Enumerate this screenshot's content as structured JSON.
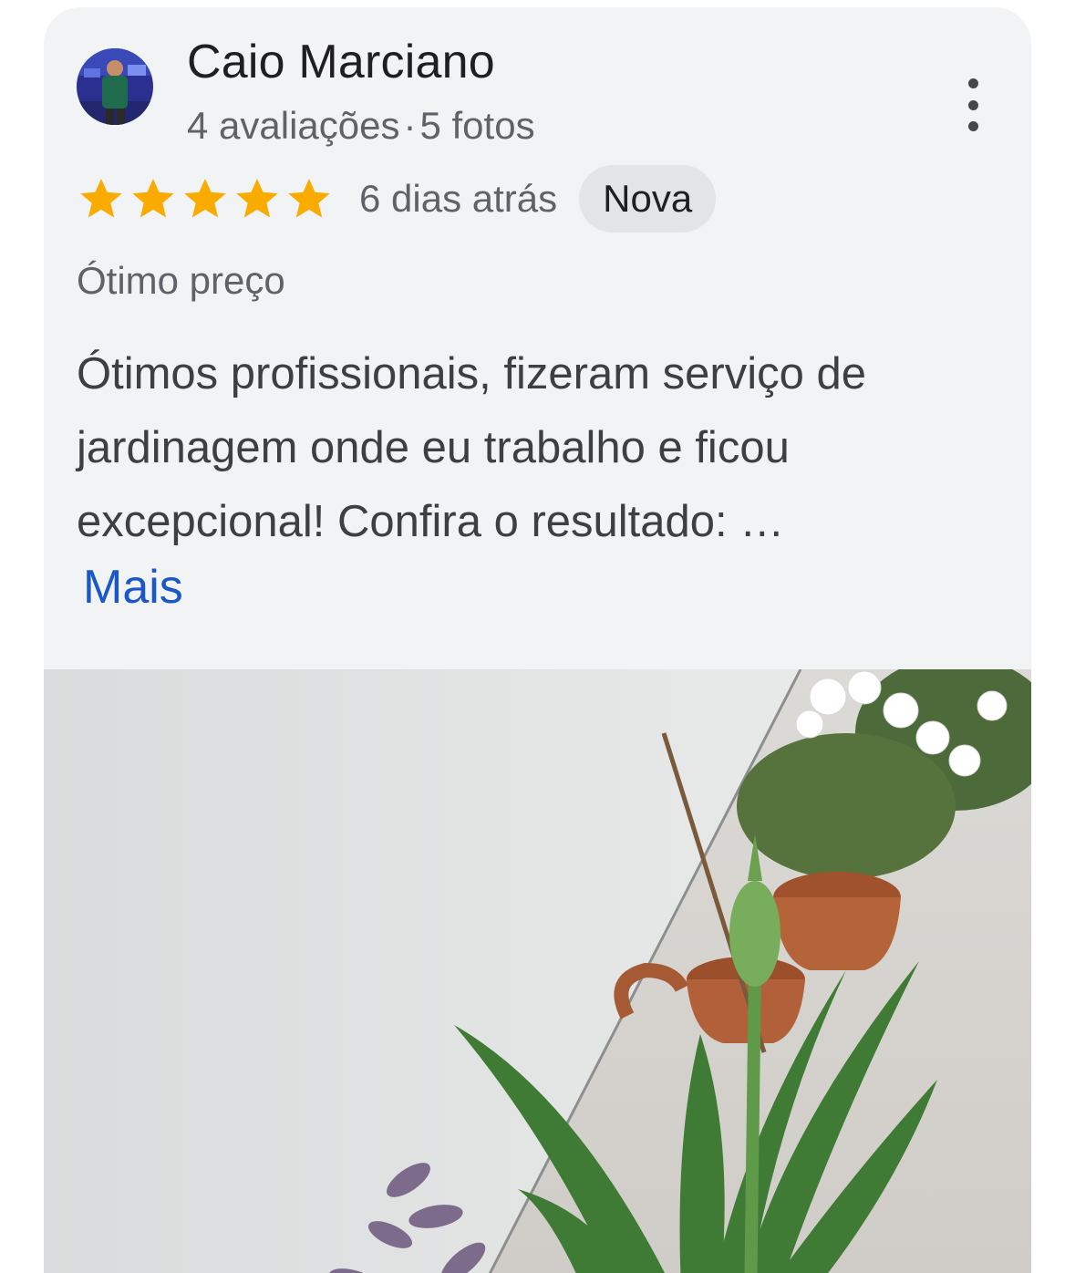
{
  "review": {
    "author": {
      "name": "Caio Marciano",
      "reviews_count": "4 avaliações",
      "separator": "·",
      "photos_count": "5 fotos"
    },
    "rating": 5,
    "rating_max": 5,
    "star_color": "#f9ab00",
    "time_ago": "6 dias atrás",
    "badge": "Nova",
    "tag": "Ótimo preço",
    "text": "Ótimos profissionais, fizeram serviço de jardinagem onde eu trabalho e ficou excepcional! Confira o resultado: …",
    "more_label": "Mais",
    "link_color": "#1a57c8"
  }
}
